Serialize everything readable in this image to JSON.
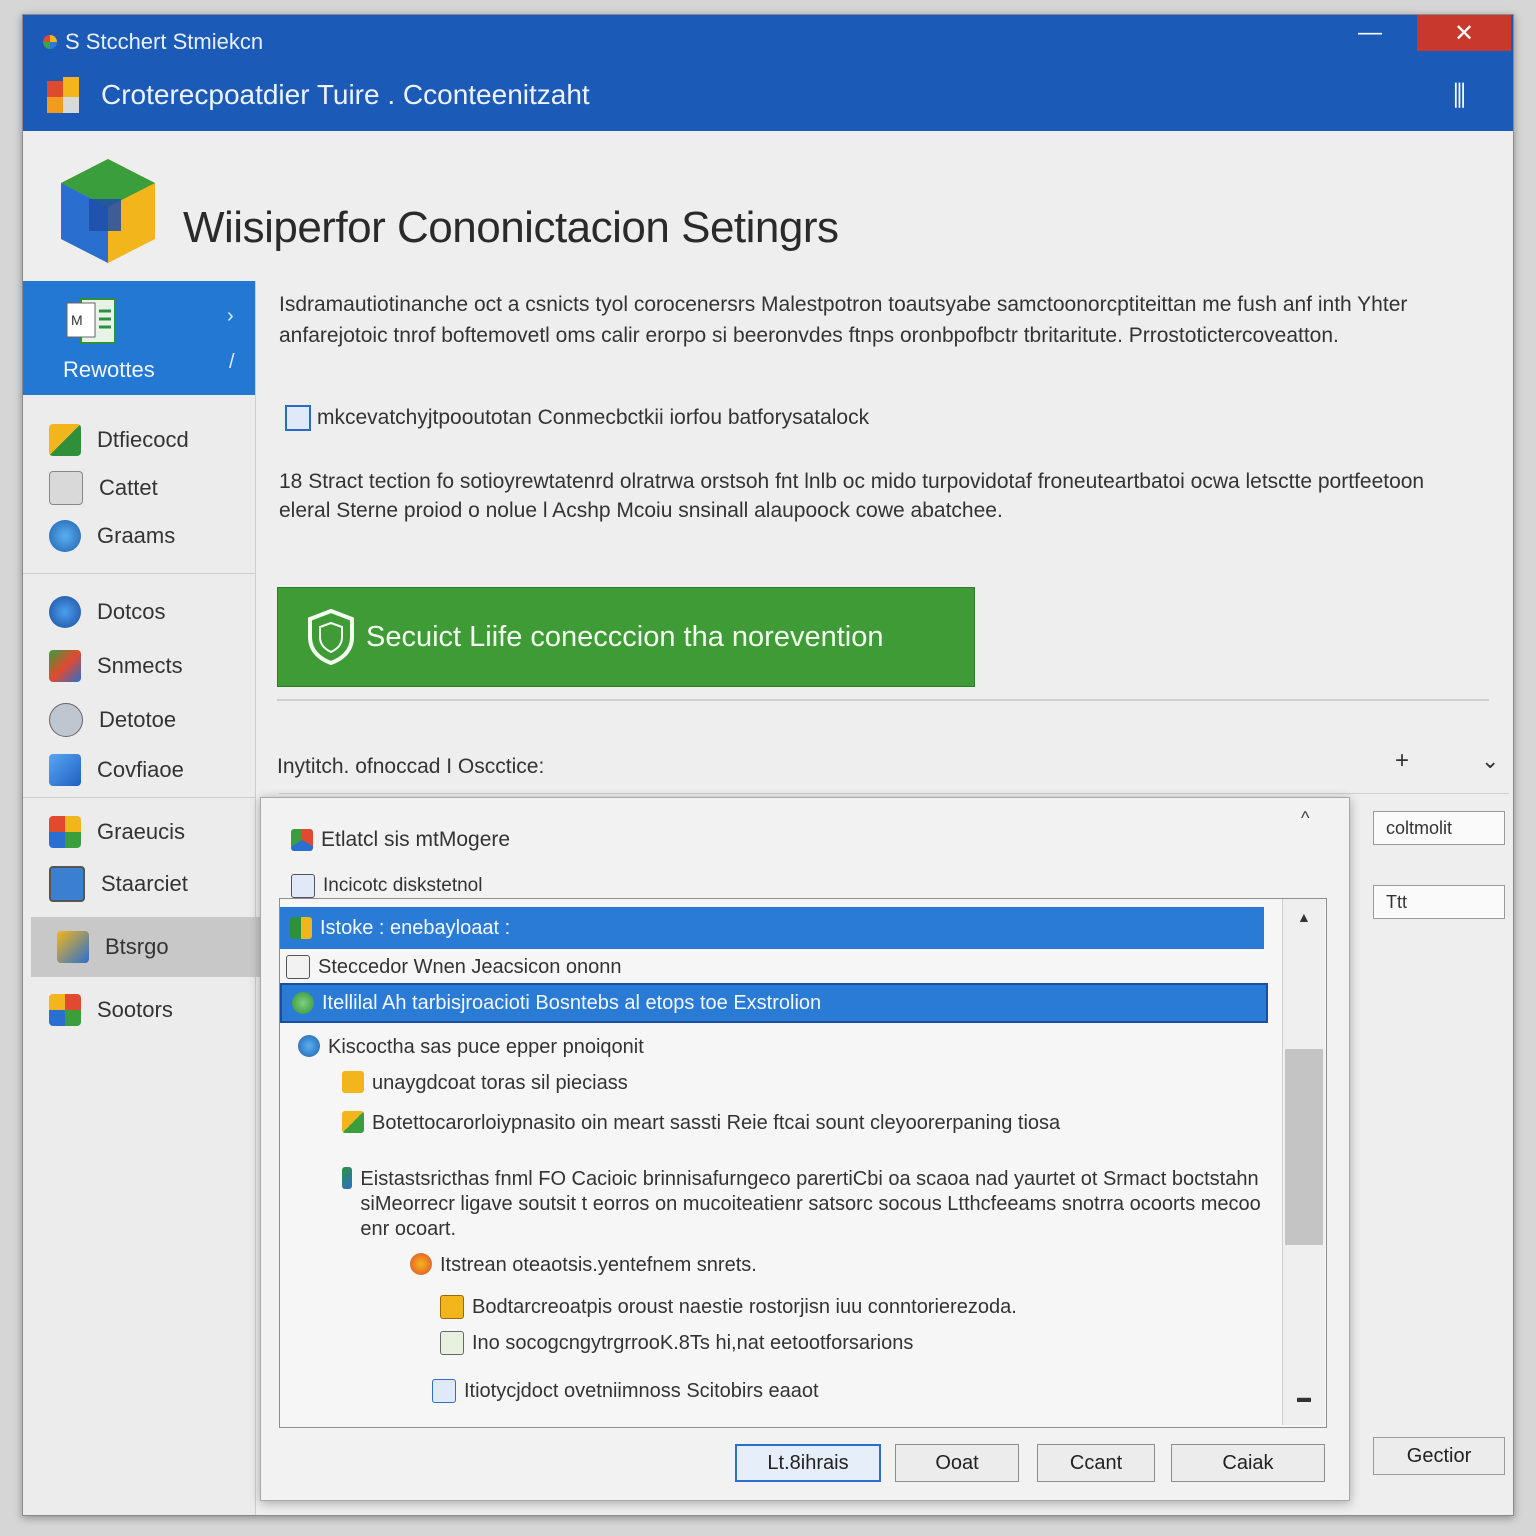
{
  "window": {
    "small_title": "S Stcchert Stmiekcn",
    "title": "Croterecpoatdier Tuire . Cconteenitzaht",
    "minimize_label": "—",
    "close_label": "✕",
    "pin_label": "⫼"
  },
  "header": {
    "title": "Wiisiperfor Cononictacion Setingrs"
  },
  "sidebar": {
    "selected_label": "Rewottes",
    "groups": [
      {
        "items": [
          {
            "label": "Dtfiecocd",
            "icon": "gift-icon"
          },
          {
            "label": "Cattet",
            "icon": "printer-icon"
          },
          {
            "label": "Graams",
            "icon": "globe-icon"
          }
        ]
      },
      {
        "items": [
          {
            "label": "Dotcos",
            "icon": "globe-icon"
          },
          {
            "label": "Snmects",
            "icon": "palette-icon"
          },
          {
            "label": "Detotoe",
            "icon": "camera-icon"
          },
          {
            "label": "Covfiaoe",
            "icon": "cube-icon"
          }
        ]
      },
      {
        "items": [
          {
            "label": "Graeucis",
            "icon": "grid-icon"
          },
          {
            "label": "Staarciet",
            "icon": "monitor-icon"
          },
          {
            "label": "Btsrgo",
            "icon": "tools-icon"
          },
          {
            "label": "Sootors",
            "icon": "windows-icon"
          }
        ]
      }
    ]
  },
  "content": {
    "description": "Isdramautiotinanche oct a csnicts tyol corocenersrs Malestpotron toautsyabe samctoonorcptiteittan me fush anf inth Yhter anfarejotoic tnrof boftemovetl oms calir erorpo si beeronvdes ftnps oronbpofbctr tbritaritute. Prrostotictercoveatton.",
    "checkbox_label": "mkcevatchyjtpooutotan Conmecbctkii iorfou batforysatalock",
    "note": "18 Stract tection fo sotioyrewtatenrd olratrwa orstsoh fnt lnlb oc mido turpovidotaf froneuteartbatoi ocwa letsctte portfeetoon eleral Sterne proiod o nolue l Acshp Mcoiu snsinall alaupoock cowe abatchee.",
    "banner_text": "Secuict Liife conecccion tha norevention",
    "section_label": "Inytitch. ofnoccad I Oscctice:",
    "section_plus": "+",
    "section_chevron": "⌄",
    "side_field_1": "coltmolit",
    "side_field_2": "Ttt",
    "side_button": "Gectior"
  },
  "dialog": {
    "caret": "^",
    "row1": "Etlatcl sis mtMogere",
    "row2": "Incicotc diskstetnol",
    "scroll_up": "▲",
    "scroll_down": "▬",
    "tree": [
      "Istoke : enebayloaat :",
      "Steccedor Wnen Jeacsicon   ononn",
      "Itellilal Ah tarbisjroacioti  Bosntebs al etops toe Exstrolion",
      "Kiscoctha sas puce epper pnoiqonit",
      "unaygdcoat toras sil pieciass",
      "Botettocarorloiypnasito oin meart sassti Reie ftcai sount cleyoorerpaning tiosa",
      "Eistastsricthas fnml FO Cacioic brinnisafurngeco parertiCbi oa scaoa nad yaurtet ot Srmact boctstahn siMeorrecr ligave soutsit t eorros on mucoiteatienr satsorc socous Ltthcfeeams snotrra ocoorts mecoo enr ocoart.",
      "Itstrean oteaotsis.yentefnem snrets.",
      "Bodtarcreoatpis oroust naestie rostorjisn iuu conntorierezoda.",
      "Ino socogcngytrgrrooK.8Ts hi,nat eetootforsarions",
      "Itiotycjdoct ovetniimnoss Scitobirs eaaot"
    ],
    "buttons": [
      "Lt.8ihrais",
      "Ooat",
      "Ccant",
      "Caiak"
    ]
  },
  "colors": {
    "titlebar": "#1c5ab7",
    "selection": "#2a7bd6",
    "banner": "#3e9b35",
    "close": "#c9382c"
  }
}
